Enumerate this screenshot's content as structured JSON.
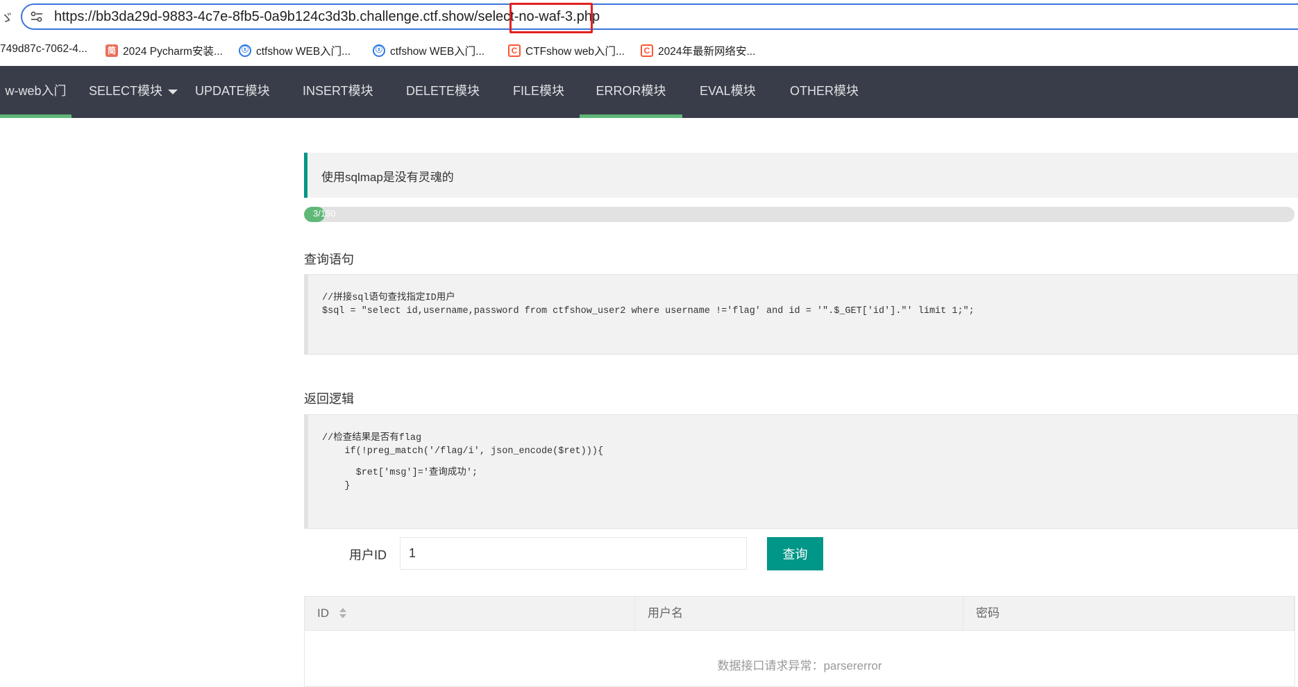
{
  "browser": {
    "left_glyph": "ゞ",
    "url": "https://bb3da29d-9883-4c7e-8fb5-0a9b124c3d3b.challenge.ctf.show/select-no-waf-3.php"
  },
  "bookmarks": [
    {
      "label": "749d87c-7062-4...",
      "icon": "none"
    },
    {
      "label": "2024 Pycharm安装...",
      "icon": "jianshu-icon",
      "glyph": "简"
    },
    {
      "label": "ctfshow WEB入门...",
      "icon": "ctfshow-icon",
      "glyph": "ⓢ"
    },
    {
      "label": "ctfshow WEB入门...",
      "icon": "ctfshow-icon",
      "glyph": "ⓢ"
    },
    {
      "label": "CTFshow web入门...",
      "icon": "csdn-icon",
      "glyph": "C"
    },
    {
      "label": "2024年最新网络安...",
      "icon": "csdn-icon",
      "glyph": "C"
    }
  ],
  "nav": {
    "items": [
      {
        "label": "w-web入门"
      },
      {
        "label": "SELECT模块"
      },
      {
        "label": "UPDATE模块"
      },
      {
        "label": "INSERT模块"
      },
      {
        "label": "DELETE模块"
      },
      {
        "label": "FILE模块"
      },
      {
        "label": "ERROR模块"
      },
      {
        "label": "EVAL模块"
      },
      {
        "label": "OTHER模块"
      }
    ],
    "accent_color": "#5fb878"
  },
  "notice": {
    "text": "使用sqlmap是没有灵魂的"
  },
  "progress": {
    "label": "3/150",
    "current": 3,
    "total": 150
  },
  "query_section": {
    "title": "查询语句",
    "code": [
      "//拼接sql语句查找指定ID用户",
      "$sql = \"select id,username,password from ctfshow_user2 where username !='flag' and id = '\".$_GET['id'].\"' limit 1;\";"
    ]
  },
  "logic_section": {
    "title": "返回逻辑",
    "code": [
      "//检查结果是否有flag",
      "    if(!preg_match('/flag/i', json_encode($ret))){",
      "      $ret['msg']='查询成功';",
      "    }"
    ]
  },
  "form": {
    "label": "用户ID",
    "value": "1",
    "button": "查询"
  },
  "table": {
    "columns": [
      "ID",
      "用户名",
      "密码"
    ],
    "empty_message": "数据接口请求异常：parsererror"
  },
  "colors": {
    "nav_bg": "#393d49",
    "primary": "#009688",
    "highlight_box": "#e02020"
  }
}
